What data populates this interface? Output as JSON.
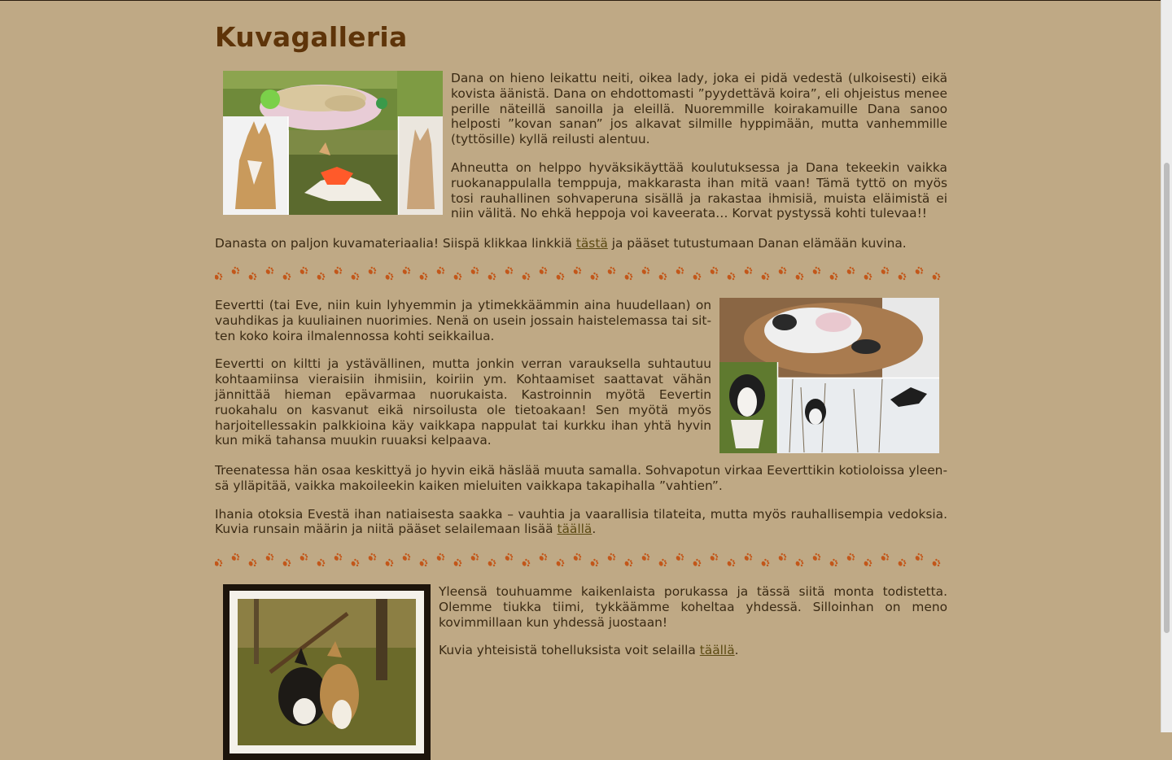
{
  "page": {
    "title": "Kuvagalleria"
  },
  "dana": {
    "image_alt": "Dana-kollaasi",
    "paragraph1": "Dana on hieno leikattu neiti, oikea lady, joka ei pidä vedestä (ulkoisesti) eikä ko­vista äänistä. Dana on ehdottomasti ”pyydettävä koira”, eli ohjeistus menee perille näteillä sanoilla ja eleillä. Nuoremmille koirakamuille Dana sanoo helposti ”kovan sanan” jos alkavat silmille hyppimään, mutta vanhemmille (tyttösille) kyl­lä reilusti alentuu.",
    "paragraph2": "Ahneutta on helppo hyväksikäyttää koulutuksessa ja Dana tekeekin vaikka ruo­kanappulalla temppuja, makkarasta ihan mitä vaan! Tämä tyttö on myös tosi rauhallinen sohvaperuna sisällä ja rakastaa ihmisiä, muista eläimistä ei niin väli­tä. No ehkä heppoja voi kaveerata… Korvat pystyssä kohti tulevaa!!",
    "link_line_before": "Danasta on paljon kuvamateriaalia! Siispä klikkaa linkkiä ",
    "link_text": "tästä",
    "link_line_after": " ja pääset tutustumaan Danan elämään kuvina."
  },
  "eevertti": {
    "paragraph1": "Eevertti (tai Eve, niin kuin lyhyemmin ja ytimekkäämmin aina huudellaan) on vauhdikas ja kuuliainen nuorimies. Nenä on usein jossain haistelemassa tai sit­ten koko koira ilmalennossa kohti seikkailua.",
    "paragraph2": "Eevertti on kiltti ja ystävällinen, mutta jonkin verran varauksella suhtautuu koh­taamiinsa vieraisiin ihmisiin, koiriin ym. Kohtaamiset saattavat vähän jännittää hieman epävarmaa nuorukaista. Kastroinnin myötä Eevertin ruokahalu on kas­vanut eikä nirsoilusta ole tietoakaan! Sen myötä myös harjoitellessakin palkkioi­na käy vaikkapa nappulat tai kurkku ihan yhtä hyvin kun mikä tahansa muukin ruuaksi kelpaava.",
    "paragraph3": "Treenatessa hän osaa keskittyä jo hyvin eikä häslää muuta samalla. Sohvapotun virkaa Eeverttikin kotioloissa yleen­sä ylläpitää, vaikka makoileekin kaiken mieluiten vaikkapa takapihalla ”vahtien”.",
    "link_line_before": "Ihania otoksia Evestä ihan natiaisesta saakka – vauhtia ja vaarallisia tilateita, mutta myös rauhallisempia vedoksia. Kuvia runsain määrin ja niitä pääset selailemaan lisää ",
    "link_text": "täällä",
    "link_line_after": "."
  },
  "together": {
    "paragraph1": "Yleensä touhuamme kaikenlaista porukassa ja tässä siitä monta todistetta. Olem­me tiukka tiimi, tykkäämme koheltaa yhdessä. Silloinhan on meno kovimmillaan kun yhdessä juostaan!",
    "link_line_before": "Kuvia yhteisistä tohelluksista voit selailla ",
    "link_text": "täällä",
    "link_line_after": "."
  },
  "colors": {
    "background": "#bfa985",
    "title": "#5e3409",
    "text": "#3a2a14",
    "link": "#5b4a12",
    "paw": "#c2571a"
  }
}
